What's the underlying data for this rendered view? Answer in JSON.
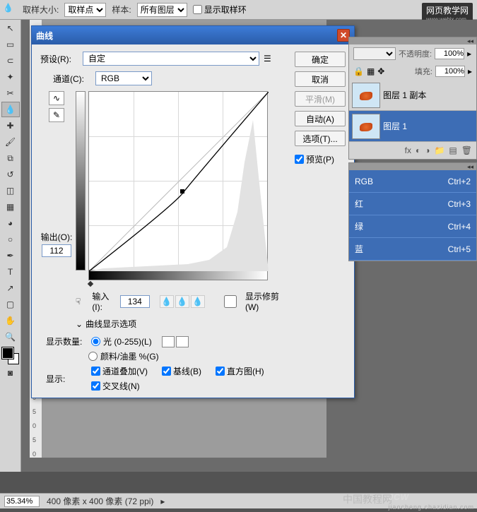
{
  "options_bar": {
    "sample_size_label": "取样大小:",
    "sample_size_value": "取样点",
    "sample_label": "样本:",
    "sample_value": "所有图层",
    "show_ring_label": "显示取样环"
  },
  "watermark_top": {
    "title": "网页教学网",
    "url": "www.webjx.com"
  },
  "dialog": {
    "title": "曲线",
    "preset_label": "预设(R):",
    "preset_value": "自定",
    "channel_label": "通道(C):",
    "channel_value": "RGB",
    "output_label": "输出(O):",
    "output_value": "112",
    "input_label": "输入(I):",
    "input_value": "134",
    "show_clipping_label": "显示修剪(W)",
    "curve_display_options": "曲线显示选项",
    "display_qty_label": "显示数量:",
    "light_label": "光 (0-255)(L)",
    "ink_label": "颜料/油墨 %(G)",
    "display_label": "显示:",
    "channel_overlay": "通道叠加(V)",
    "baseline": "基线(B)",
    "histogram_chk": "直方图(H)",
    "intersection": "交叉线(N)",
    "buttons": {
      "ok": "确定",
      "cancel": "取消",
      "smooth": "平滑(M)",
      "auto": "自动(A)",
      "options": "选项(T)...",
      "preview": "预览(P)"
    }
  },
  "layers_panel": {
    "opacity_label": "不透明度:",
    "opacity_value": "100%",
    "fill_label": "填充:",
    "fill_value": "100%",
    "layer1_copy": "图层 1 副本",
    "layer1": "图层 1"
  },
  "channels_panel": {
    "items": [
      {
        "name": "RGB",
        "shortcut": "Ctrl+2"
      },
      {
        "name": "红",
        "shortcut": "Ctrl+3"
      },
      {
        "name": "绿",
        "shortcut": "Ctrl+4"
      },
      {
        "name": "蓝",
        "shortcut": "Ctrl+5"
      }
    ]
  },
  "status_bar": {
    "zoom": "35.34%",
    "doc_info": "400 像素 x 400 像素 (72 ppi)"
  },
  "chart_data": {
    "type": "line",
    "title": "曲线",
    "xlabel": "输入",
    "ylabel": "输出",
    "xlim": [
      0,
      255
    ],
    "ylim": [
      0,
      255
    ],
    "series": [
      {
        "name": "curve",
        "x": [
          0,
          134,
          255
        ],
        "y": [
          0,
          112,
          255
        ]
      },
      {
        "name": "baseline",
        "x": [
          0,
          255
        ],
        "y": [
          0,
          255
        ]
      }
    ],
    "selected_point": {
      "input": 134,
      "output": 112
    }
  },
  "ruler_marks": [
    "0",
    "5",
    "0",
    "5",
    "0"
  ],
  "bottom_wm1": "中国教程网",
  "bottom_wm2": {
    "big": "JCW",
    "small": "jiaocheng.chazidian.com"
  }
}
